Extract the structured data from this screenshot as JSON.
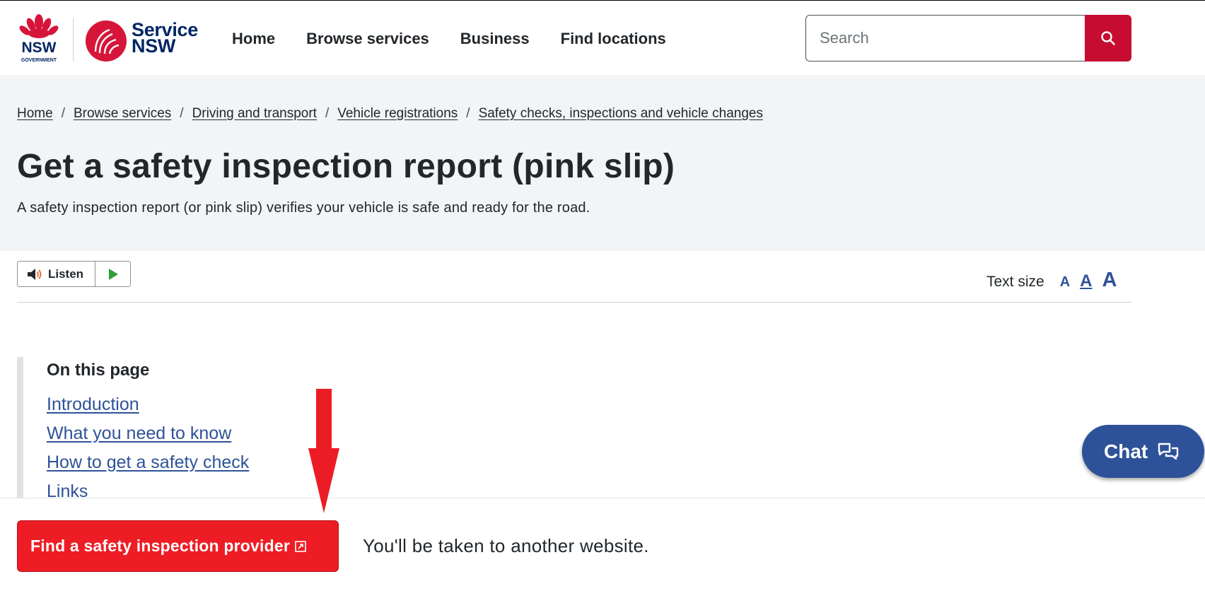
{
  "header": {
    "logo_nsw": {
      "primary": "NSW",
      "secondary": "GOVERNMENT"
    },
    "logo_service": {
      "line1": "Service",
      "line2": "NSW"
    },
    "nav": [
      "Home",
      "Browse services",
      "Business",
      "Find locations"
    ],
    "search": {
      "placeholder": "Search",
      "button_icon": "search-icon"
    }
  },
  "breadcrumb": {
    "items": [
      "Home",
      "Browse services",
      "Driving and transport",
      "Vehicle registrations",
      "Safety checks, inspections and vehicle changes"
    ],
    "separator": "/"
  },
  "page": {
    "title": "Get a safety inspection report (pink slip)",
    "intro": "A safety inspection report (or pink slip) verifies your vehicle is safe and ready for the road."
  },
  "toolbar": {
    "listen_label": "Listen",
    "text_size_label": "Text size",
    "text_size_options": [
      "A",
      "A",
      "A"
    ],
    "selected_text_size": 2
  },
  "on_this_page": {
    "title": "On this page",
    "links": [
      "Introduction",
      "What you need to know",
      "How to get a safety check",
      "Links"
    ]
  },
  "chat": {
    "label": "Chat"
  },
  "cta": {
    "button_label": "Find a safety inspection provider",
    "note": "You'll be taken to another website."
  },
  "colors": {
    "brand_red": "#c60c30",
    "cta_red": "#ee1c25",
    "link_blue": "#2e5299",
    "navy": "#002664",
    "banner_bg": "#f2f4f6",
    "annotation_arrow": "#ec1c24"
  }
}
